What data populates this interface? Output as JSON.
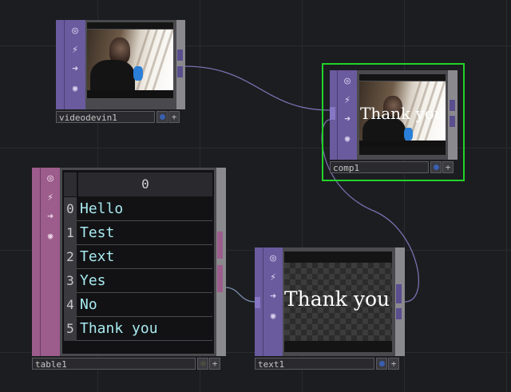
{
  "nodes": {
    "videodevin": {
      "name": "videodevin1"
    },
    "comp": {
      "name": "comp1",
      "overlay_text": "Thank you"
    },
    "text": {
      "name": "text1",
      "display_text": "Thank you"
    },
    "table": {
      "name": "table1",
      "column_header": "0",
      "rows": [
        {
          "index": "0",
          "value": "Hello"
        },
        {
          "index": "1",
          "value": "Test"
        },
        {
          "index": "2",
          "value": "Text"
        },
        {
          "index": "3",
          "value": "Yes"
        },
        {
          "index": "4",
          "value": "No"
        },
        {
          "index": "5",
          "value": "Thank you"
        }
      ]
    }
  },
  "icons": {
    "viewer": "◎",
    "bypass": "⚡",
    "output": "➜",
    "lock": "🔒",
    "add": "+"
  },
  "colors": {
    "top_family": "#6a5a9e",
    "dat_family": "#9c5c8c",
    "selected": "#22d32a",
    "wire": "#7b6fb0",
    "table_text": "#a8eaf0"
  }
}
